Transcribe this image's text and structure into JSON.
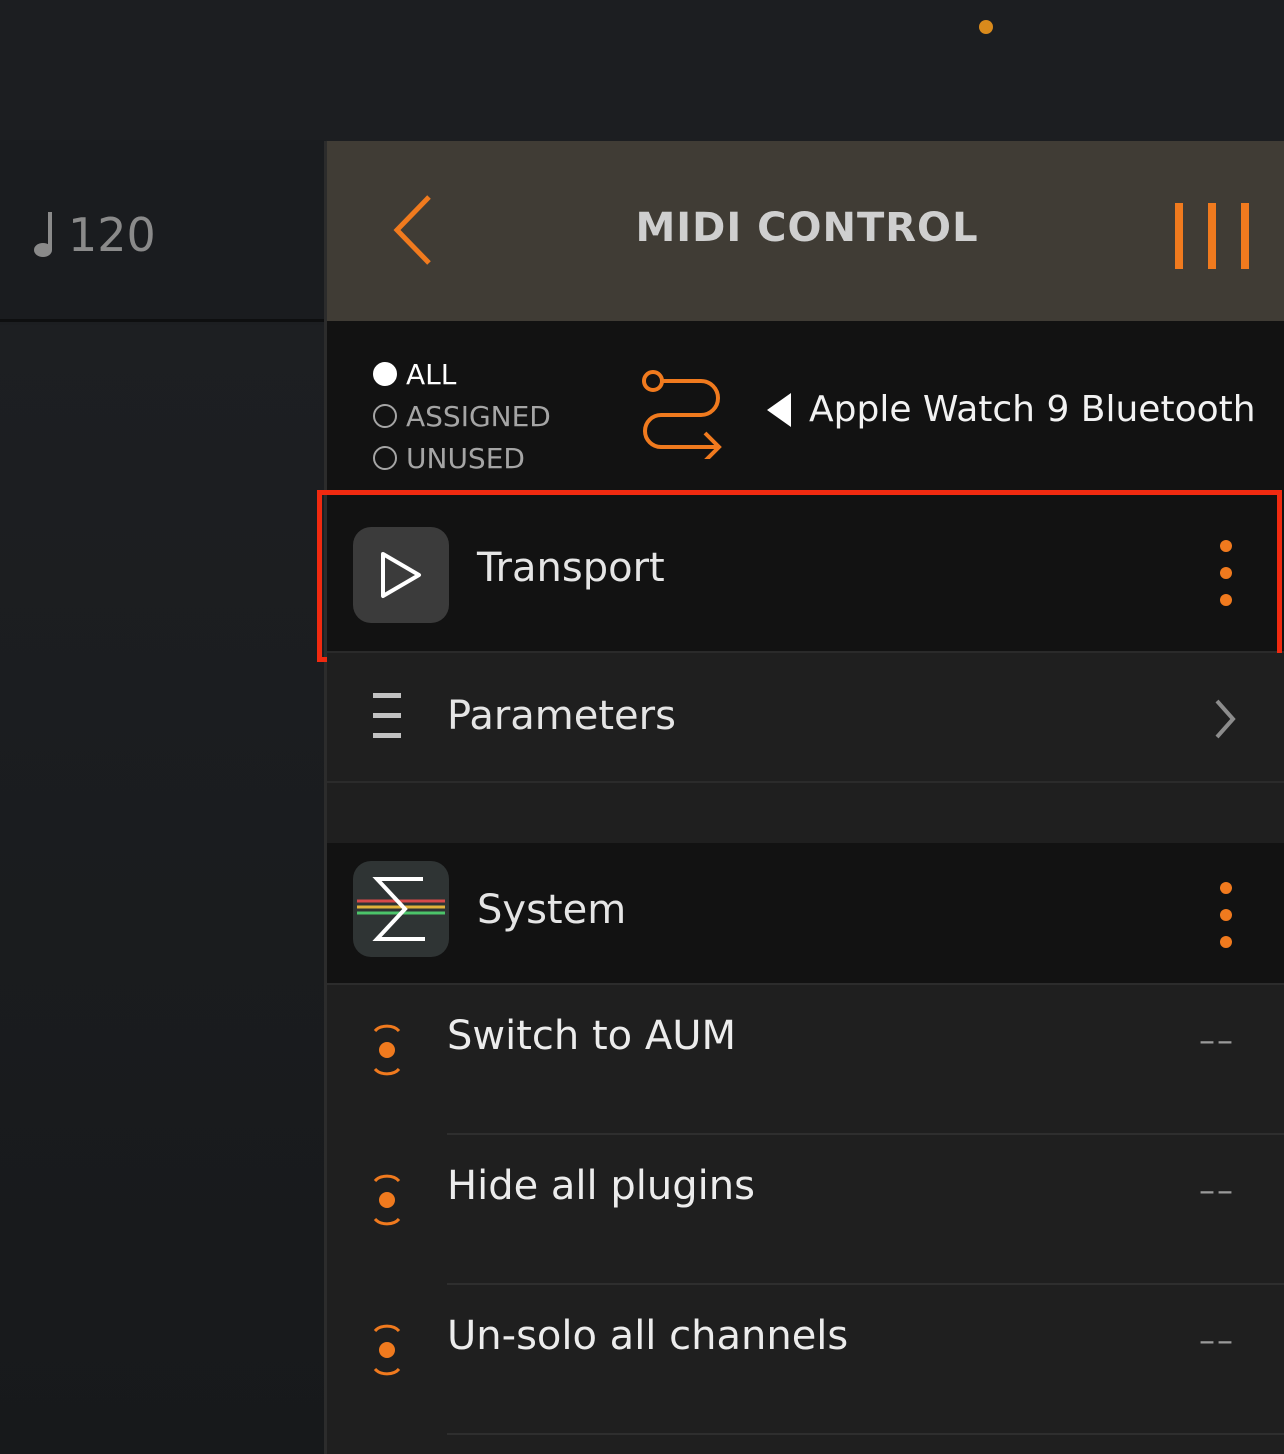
{
  "tempo": {
    "value": "120"
  },
  "panel": {
    "title": "MIDI CONTROL"
  },
  "filters": [
    {
      "label": "ALL",
      "selected": true
    },
    {
      "label": "ASSIGNED",
      "selected": false
    },
    {
      "label": "UNUSED",
      "selected": false
    }
  ],
  "device": {
    "name": "Apple Watch 9 Bluetooth"
  },
  "sections": {
    "transport": {
      "label": "Transport"
    },
    "parameters": {
      "label": "Parameters"
    },
    "system": {
      "label": "System"
    }
  },
  "system_items": [
    {
      "label": "Switch to AUM",
      "value": "––"
    },
    {
      "label": "Hide all plugins",
      "value": "––"
    },
    {
      "label": "Un-solo all channels",
      "value": "––"
    }
  ],
  "colors": {
    "accent": "#f07a1e",
    "header_bg": "#403c35",
    "highlight": "#f02a10"
  },
  "icons": {
    "back": "chevron-left-icon",
    "menu": "triple-bar-icon",
    "route": "routing-arrow-icon",
    "transport": "play-icon",
    "parameters": "list-icon",
    "system": "sigma-icon",
    "learn": "midi-learn-icon"
  }
}
